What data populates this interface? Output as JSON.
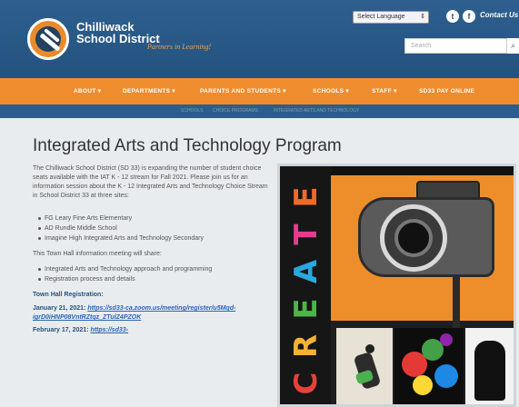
{
  "header": {
    "logo_line1": "Chilliwack",
    "logo_line2": "School District",
    "tagline": "Partners in Learning!",
    "language_select": "Select Language",
    "contact": "Contact Us",
    "search_placeholder": "Search"
  },
  "nav": {
    "items": [
      {
        "label": "ABOUT ▾"
      },
      {
        "label": "DEPARTMENTS ▾"
      },
      {
        "label": "PARENTS AND STUDENTS ▾"
      },
      {
        "label": "SCHOOLS ▾"
      },
      {
        "label": "STAFF ▾"
      },
      {
        "label": "SD33 PAY ONLINE"
      }
    ]
  },
  "breadcrumb": {
    "items": [
      "SCHOOLS",
      "CHOICE PROGRAMS",
      "INTEGRATED ARTS AND TECHNOLOGY"
    ]
  },
  "main": {
    "title": "Integrated Arts and Technology Program",
    "intro": "The Chilliwack School District (SD 33) is expanding the number of student choice seats available with the IAT K - 12 stream for Fall 2021. Please join us for an information session about the K - 12 Integrated Arts and Technology Choice Stream in School District 33 at three sites:",
    "sites": [
      "FG Leary Fine Arts Elementary",
      "AD Rundle Middle School",
      "Imagine High Integrated Arts and Technology Secondary"
    ],
    "town_hall_intro": "This Town Hall information meeting will share:",
    "share_items": [
      "Integrated Arts and Technology approach and programming",
      "Registration process and details"
    ],
    "registration_heading": "Town Hall Registration:",
    "reg1_date": "January 21, 2021: ",
    "reg1_link": "https://sd33-ca.zoom.us/meeting/register/u5Mqd-igrD0iHNP08VntRZtqz_ZTulZ4PZOK",
    "reg2_date": "February 17, 2021: ",
    "reg2_link": "https://sd33-"
  },
  "art": {
    "letters": [
      "C",
      "R",
      "E",
      "A",
      "T",
      "E"
    ],
    "letter_colors": [
      "#e8413a",
      "#f5b335",
      "#4cb648",
      "#2aa8e0",
      "#e53d8e",
      "#f06a2a"
    ]
  }
}
